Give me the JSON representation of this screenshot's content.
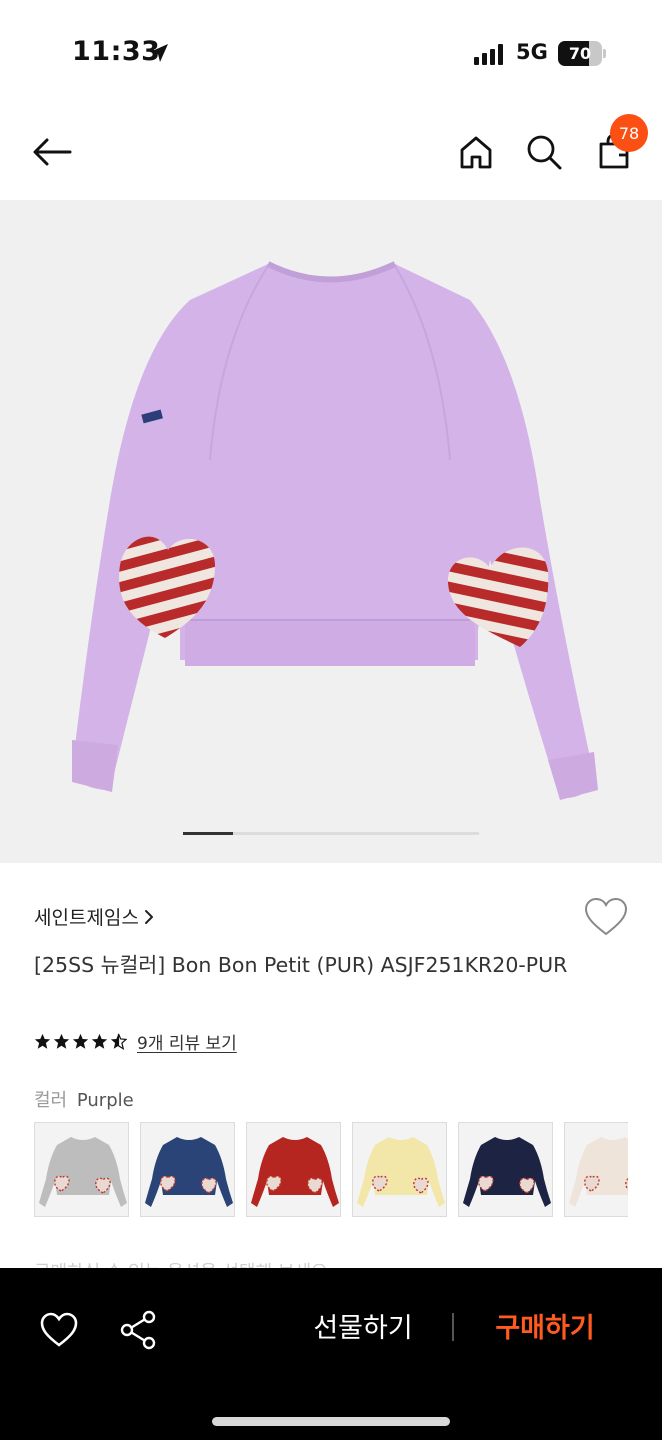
{
  "status_bar": {
    "time": "11:33",
    "network": "5G",
    "battery": "70",
    "battery_level": 0.7
  },
  "top_nav": {
    "back_icon": "arrow-left-icon",
    "home_icon": "home-icon",
    "search_icon": "search-icon",
    "bag_icon": "shopping-bag-icon",
    "bag_badge": "78",
    "badge_color": "#fb4f14"
  },
  "gallery": {
    "image_description": "lavender sweatshirt with striped heart elbow patches",
    "main_color": "#d4b4e8",
    "current_index": 1,
    "progress_fraction": 0.17
  },
  "product": {
    "brand": "세인트제임스",
    "brand_chevron": "›",
    "title": "[25SS 뉴컬러] Bon Bon Petit (PUR) ASJF251KR20-PUR",
    "rating": 4.5,
    "review_link": "9개 리뷰 보기",
    "color_label": "컬러",
    "color_value": "Purple",
    "swatches": [
      {
        "name": "gray",
        "hex": "#bdbdbd"
      },
      {
        "name": "blue",
        "hex": "#2a4478"
      },
      {
        "name": "red",
        "hex": "#b4261f"
      },
      {
        "name": "yellow",
        "hex": "#f2e7a9"
      },
      {
        "name": "navy",
        "hex": "#1d2342"
      },
      {
        "name": "ivory",
        "hex": "#eee4d9"
      }
    ],
    "faded_notice": "구매하실 수 있는 옵션을 선택해 보세요"
  },
  "bottom_bar": {
    "wish_icon": "heart-outline-icon",
    "share_icon": "share-icon",
    "gift_label": "선물하기",
    "buy_label": "구매하기",
    "buy_color": "#ff5a1f"
  }
}
